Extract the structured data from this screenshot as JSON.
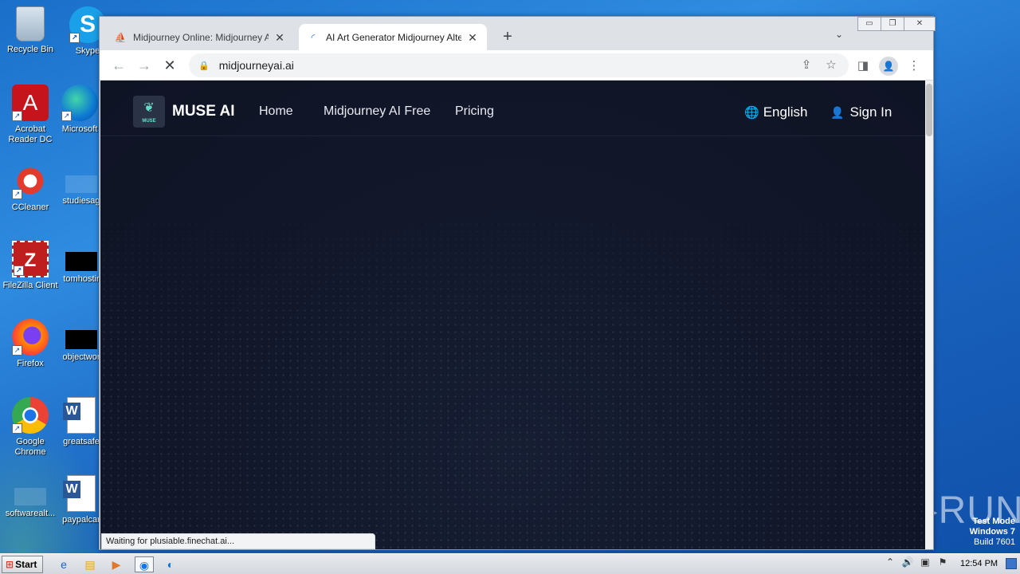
{
  "desktop": {
    "icons": [
      {
        "label": "Recycle Bin",
        "glyph": ""
      },
      {
        "label": "Skype",
        "glyph": "S"
      },
      {
        "label": "Acrobat Reader DC",
        "glyph": "A"
      },
      {
        "label": "Microsoft",
        "glyph": ""
      },
      {
        "label": "CCleaner",
        "glyph": ""
      },
      {
        "label": "studiesag",
        "glyph": ""
      },
      {
        "label": "FileZilla Client",
        "glyph": "Z"
      },
      {
        "label": "tomhostir",
        "glyph": ""
      },
      {
        "label": "Firefox",
        "glyph": ""
      },
      {
        "label": "objectwor",
        "glyph": ""
      },
      {
        "label": "Google Chrome",
        "glyph": ""
      },
      {
        "label": "greatsafe",
        "glyph": ""
      },
      {
        "label": "softwarealt...",
        "glyph": ""
      },
      {
        "label": "paypalcar",
        "glyph": ""
      }
    ]
  },
  "browser": {
    "tabs": [
      {
        "title": "Midjourney Online: Midjourney Ai On",
        "favicon": "sail-icon",
        "active": false
      },
      {
        "title": "AI Art Generator Midjourney Alterna",
        "favicon": "loading-icon",
        "active": true
      }
    ],
    "new_tab_glyph": "+",
    "tab_search_glyph": "⌄",
    "window_controls": {
      "minimize": "▭",
      "restore": "❐",
      "close": "✕"
    },
    "address": "midjourneyai.ai",
    "status_text": "Waiting for plusiable.finechat.ai..."
  },
  "site": {
    "logo_text": "MUSE",
    "brand": "MUSE AI",
    "nav": [
      "Home",
      "Midjourney AI Free",
      "Pricing"
    ],
    "language": "English",
    "sign_in": "Sign In"
  },
  "watermark": {
    "text": "ANY▷RUN",
    "test_mode": "Test Mode",
    "os": "Windows 7",
    "build": "Build 7601"
  },
  "taskbar": {
    "start_label": "Start",
    "clock": "12:54 PM"
  }
}
